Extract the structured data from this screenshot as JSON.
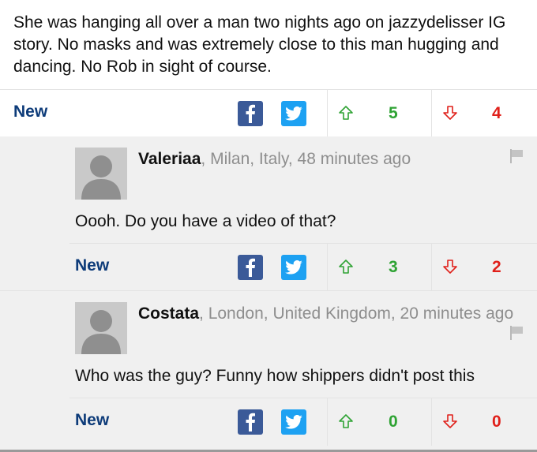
{
  "main": {
    "text": "She was hanging all over a man two nights ago on jazzydelisser IG story. No masks and was extremely close to this man hugging and dancing. No Rob in sight of course.",
    "actions": {
      "new_label": "New",
      "up_count": "5",
      "down_count": "4"
    }
  },
  "replies": [
    {
      "author": "Valeriaa",
      "meta": ", Milan, Italy, 48 minutes ago",
      "text": "Oooh. Do you have a video of that?",
      "actions": {
        "new_label": "New",
        "up_count": "3",
        "down_count": "2"
      }
    },
    {
      "author": "Costata",
      "meta": ", London, United Kingdom, 20 minutes ago",
      "text": "Who was the guy? Funny how shippers didn't post this",
      "actions": {
        "new_label": "New",
        "up_count": "0",
        "down_count": "0"
      }
    }
  ],
  "icons": {
    "facebook": "facebook-icon",
    "twitter": "twitter-icon",
    "upvote": "arrow-up-icon",
    "downvote": "arrow-down-icon",
    "flag": "flag-icon",
    "avatar": "avatar-placeholder"
  },
  "colors": {
    "new_link": "#0d3b79",
    "facebook": "#3b5a98",
    "twitter": "#1da1f2",
    "upvote": "#2fa334",
    "downvote": "#e0201a",
    "reply_background": "#f0f0f0"
  }
}
